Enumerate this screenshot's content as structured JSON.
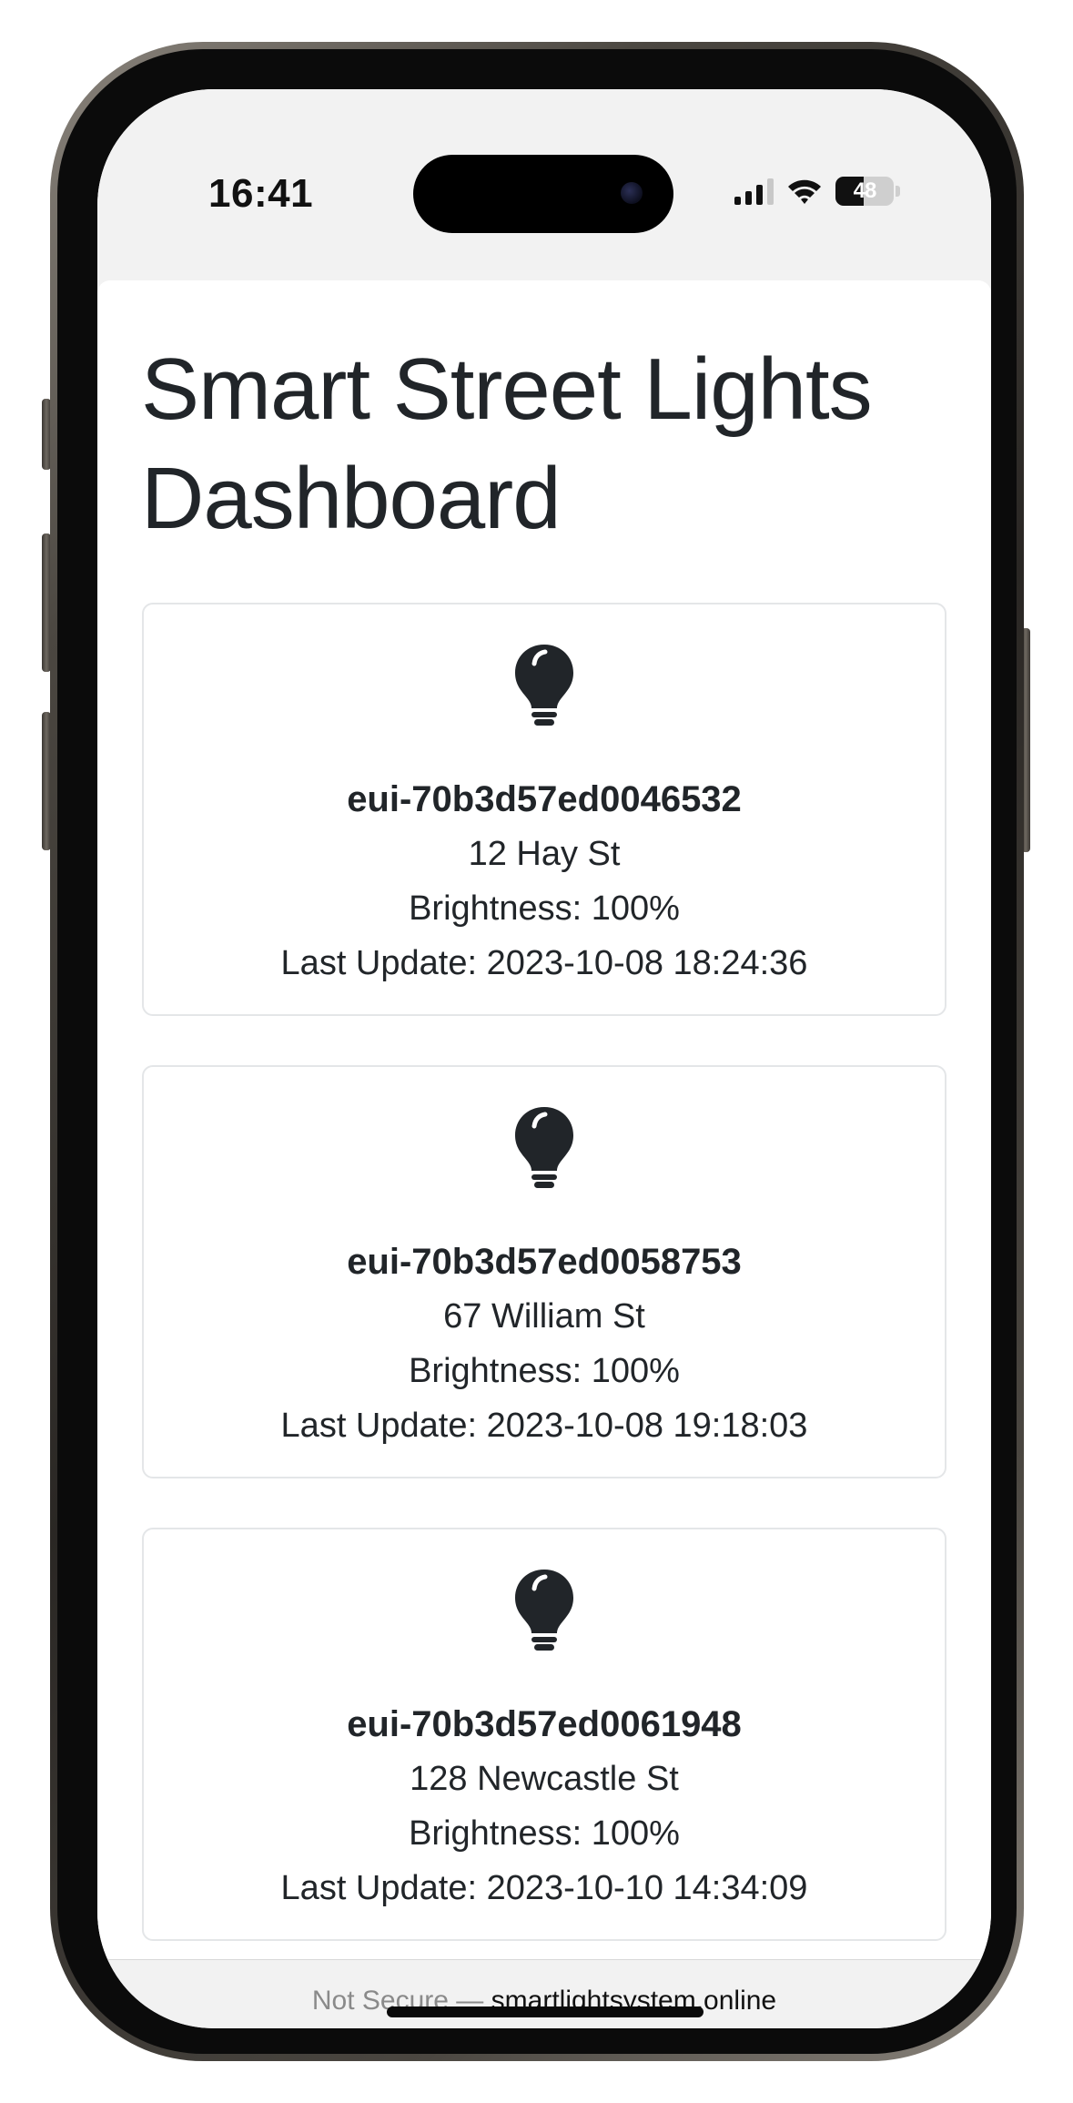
{
  "status_bar": {
    "time": "16:41",
    "battery_level": "48",
    "battery_fraction": 0.48,
    "signal_bars_active": 3,
    "signal_bars_total": 4,
    "icons": [
      "cellular-signal-icon",
      "wifi-icon",
      "battery-icon"
    ]
  },
  "page": {
    "title": "Smart Street Lights Dashboard"
  },
  "lights": [
    {
      "icon": "lightbulb-icon",
      "id": "eui-70b3d57ed0046532",
      "address": "12 Hay St",
      "brightness": "Brightness: 100%",
      "last_update": "Last Update: 2023-10-08 18:24:36"
    },
    {
      "icon": "lightbulb-icon",
      "id": "eui-70b3d57ed0058753",
      "address": "67 William St",
      "brightness": "Brightness: 100%",
      "last_update": "Last Update: 2023-10-08 19:18:03"
    },
    {
      "icon": "lightbulb-icon",
      "id": "eui-70b3d57ed0061948",
      "address": "128 Newcastle St",
      "brightness": "Brightness: 100%",
      "last_update": "Last Update: 2023-10-10 14:34:09"
    }
  ],
  "browser": {
    "security_label": "Not Secure —",
    "domain": "smartlightsystem.online"
  },
  "colors": {
    "text": "#212529",
    "card_border": "#e4e6e8",
    "chrome_background": "#f2f2f2",
    "security_label": "#8a8a8a"
  }
}
